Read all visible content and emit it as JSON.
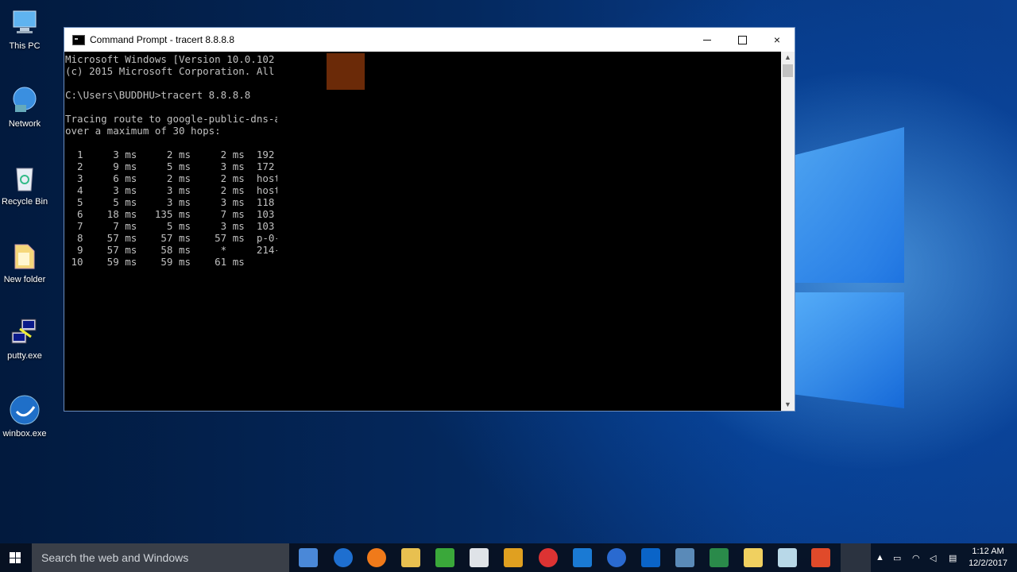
{
  "desktop": {
    "icons": [
      {
        "label": "This PC",
        "icon": "this-pc-icon"
      },
      {
        "label": "Network",
        "icon": "network-icon"
      },
      {
        "label": "Recycle Bin",
        "icon": "recycle-bin-icon"
      },
      {
        "label": "New folder",
        "icon": "folder-icon"
      },
      {
        "label": "putty.exe",
        "icon": "putty-icon"
      },
      {
        "label": "winbox.exe",
        "icon": "winbox-icon"
      }
    ]
  },
  "window": {
    "title": "Command Prompt - tracert  8.8.8.8",
    "buttons": {
      "minimize": "minimize",
      "maximize": "maximize",
      "close": "×"
    }
  },
  "console": {
    "lines": [
      "Microsoft Windows [Version 10.0.102",
      "(c) 2015 Microsoft Corporation. All",
      "",
      "C:\\Users\\BUDDHU>tracert 8.8.8.8",
      "",
      "Tracing route to google-public-dns-a",
      "over a maximum of 30 hops:",
      "",
      "  1     3 ms     2 ms     2 ms  192",
      "  2     9 ms     5 ms     3 ms  172",
      "  3     6 ms     2 ms     2 ms  host",
      "  4     3 ms     3 ms     2 ms  host",
      "  5     5 ms     3 ms     3 ms  118",
      "  6    18 ms   135 ms     7 ms  103",
      "  7     7 ms     5 ms     3 ms  103",
      "  8    57 ms    57 ms    57 ms  p-0-",
      "  9    57 ms    58 ms     *     214-",
      " 10    59 ms    59 ms    61 ms"
    ]
  },
  "taskbar": {
    "search_placeholder": "Search the web and Windows",
    "apps": [
      "task-view-icon",
      "edge-icon",
      "firefox-icon",
      "file-explorer-icon",
      "camtasia-icon",
      "store-icon",
      "app-icon",
      "chrome-icon",
      "teamviewer-icon",
      "ie-icon",
      "outlook-icon",
      "network-app-icon",
      "fbs-icon",
      "folder-icon",
      "notepad-icon",
      "app-c-icon",
      "cmd-icon"
    ],
    "clock_time": "1:12 AM",
    "clock_date": "12/2/2017"
  }
}
